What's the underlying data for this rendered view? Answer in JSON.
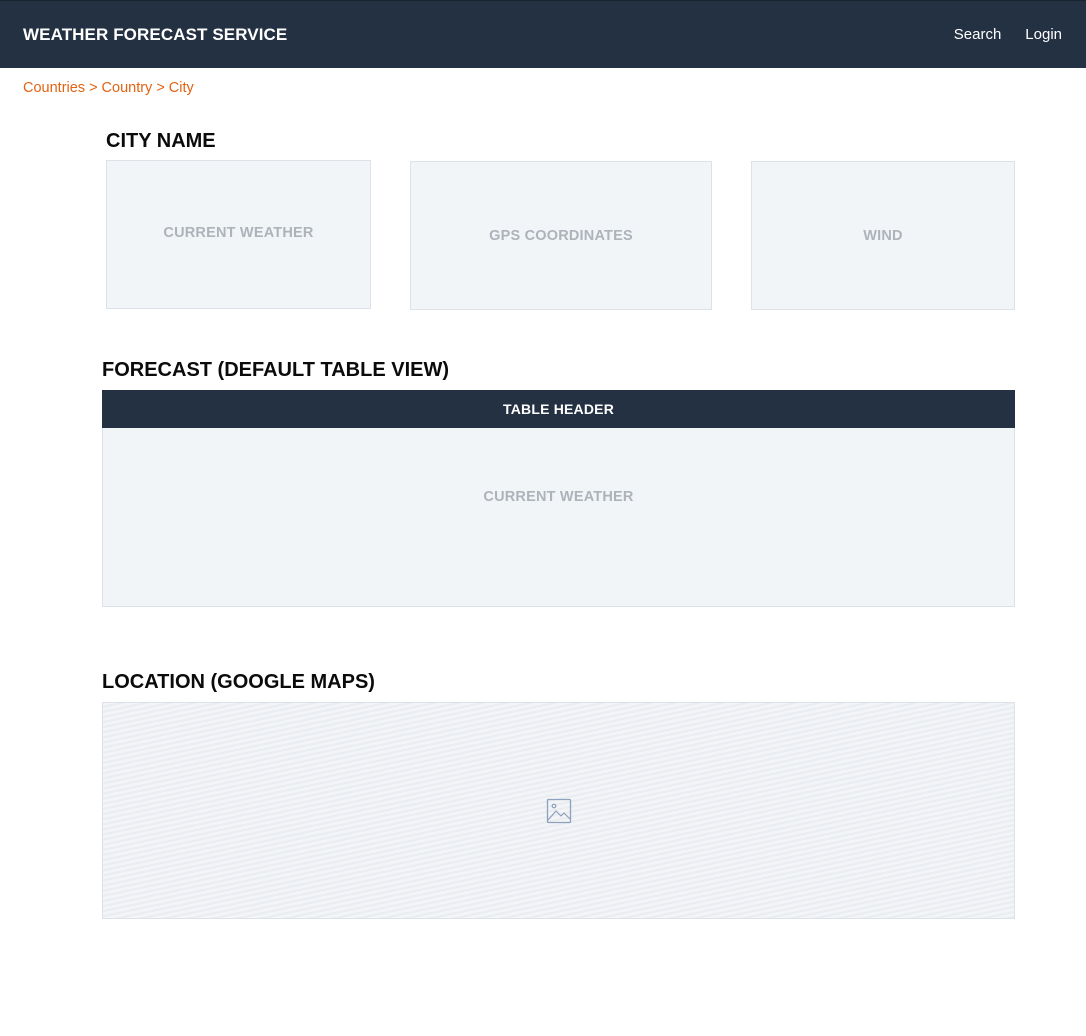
{
  "header": {
    "brand": "WEATHER FORECAST SERVICE",
    "nav": [
      {
        "label": "Search"
      },
      {
        "label": "Login"
      }
    ]
  },
  "breadcrumb": {
    "items": [
      "Countries",
      "Country",
      "City"
    ],
    "separator": ">"
  },
  "city": {
    "title": "CITY NAME",
    "cards": [
      {
        "label": "CURRENT WEATHER"
      },
      {
        "label": "GPS COORDINATES"
      },
      {
        "label": "WIND"
      }
    ]
  },
  "forecast": {
    "title": "FORECAST (DEFAULT TABLE VIEW)",
    "table_header": "TABLE HEADER",
    "table_body_label": "CURRENT WEATHER"
  },
  "location": {
    "title": "LOCATION (GOOGLE MAPS)",
    "map_icon": "image-placeholder-icon"
  },
  "colors": {
    "header_bg": "#243142",
    "accent": "#e26313",
    "placeholder_bg": "#f2f5f8",
    "placeholder_text": "#aeb3ba"
  }
}
